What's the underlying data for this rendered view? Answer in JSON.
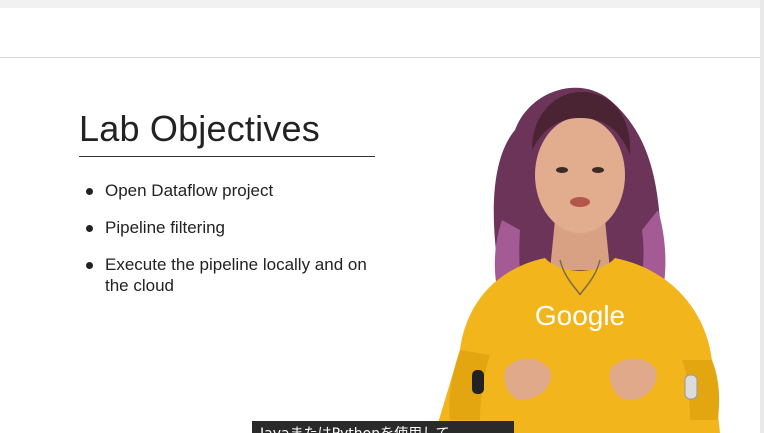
{
  "slide": {
    "title": "Lab Objectives",
    "objectives": [
      "Open Dataflow project",
      "Pipeline filtering",
      "Execute the pipeline locally and on the cloud"
    ]
  },
  "presenter": {
    "shirt_logo": "Google",
    "shirt_color": "#f2b51c",
    "hair_color": "#7a3a64"
  },
  "caption": {
    "text": "JavaまたはPythonを使用して"
  }
}
